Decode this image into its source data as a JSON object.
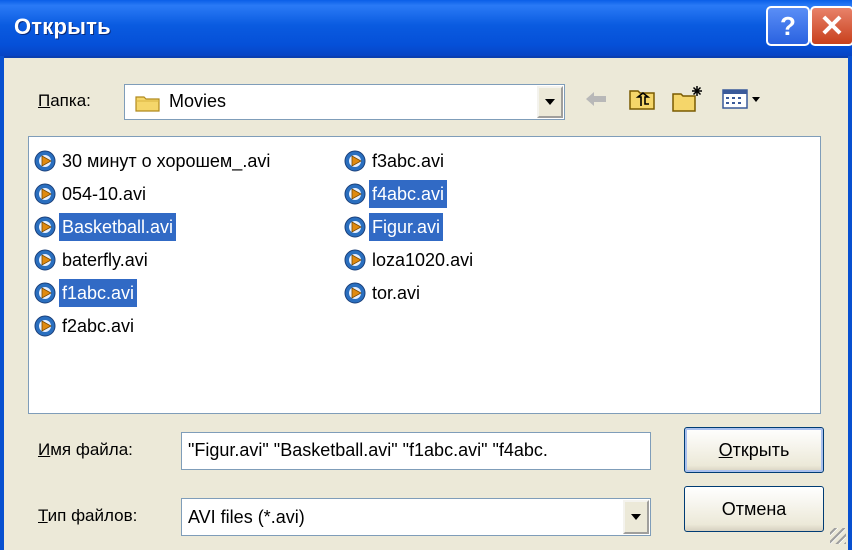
{
  "window": {
    "title": "Открыть",
    "help_label": "?",
    "close_label": "✕"
  },
  "look_in": {
    "label_u": "П",
    "label_rest": "апка:",
    "value": "Movies"
  },
  "toolbar": {
    "icons": [
      "back-arrow-icon",
      "up-folder-icon",
      "new-folder-icon",
      "view-menu-icon"
    ]
  },
  "files": [
    {
      "name": "30 минут о хорошем_.avi",
      "selected": false
    },
    {
      "name": "054-10.avi",
      "selected": false
    },
    {
      "name": "Basketball.avi",
      "selected": true
    },
    {
      "name": "baterfly.avi",
      "selected": false
    },
    {
      "name": "f1abc.avi",
      "selected": true
    },
    {
      "name": "f2abc.avi",
      "selected": false
    },
    {
      "name": "f3abc.avi",
      "selected": false
    },
    {
      "name": "f4abc.avi",
      "selected": true
    },
    {
      "name": "Figur.avi",
      "selected": true
    },
    {
      "name": "loza1020.avi",
      "selected": false
    },
    {
      "name": "tor.avi",
      "selected": false
    }
  ],
  "filename": {
    "label_u": "И",
    "label_rest": "мя файла:",
    "value": "\"Figur.avi\" \"Basketball.avi\" \"f1abc.avi\" \"f4abc."
  },
  "filetype": {
    "label_u": "Т",
    "label_rest": "ип файлов:",
    "value": "AVI files (*.avi)"
  },
  "buttons": {
    "open_u": "О",
    "open_rest": "ткрыть",
    "cancel": "Отмена"
  },
  "colors": {
    "selection": "#316ac5",
    "titlebar": "#0a5be0",
    "face": "#ece9d8"
  }
}
